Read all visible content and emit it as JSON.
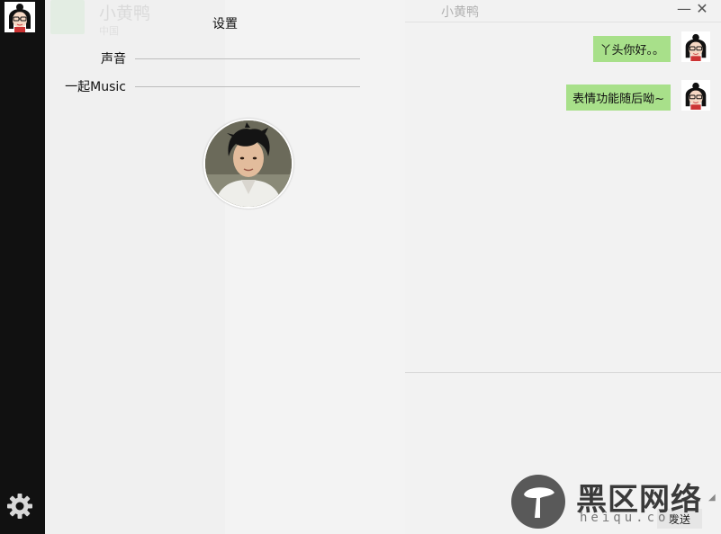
{
  "rail": {
    "avatar_icon": "cartoon-girl-avatar",
    "settings_icon": "gear-icon"
  },
  "drawer": {
    "title": "设置",
    "ghost_contact": {
      "name": "小黄鸭",
      "sub": "中国"
    },
    "settings": [
      {
        "label": "声音"
      },
      {
        "label": "一起Music"
      }
    ],
    "profile_icon": "profile-photo"
  },
  "chat": {
    "title": "小黄鸭",
    "minimize": "—",
    "close": "✕",
    "messages": [
      {
        "text": "丫头你好。。"
      },
      {
        "text": "表情功能随后呦~"
      }
    ],
    "send_label": "发送",
    "bubble_color": "#a8e08a"
  },
  "watermark": {
    "title": "黑区网络",
    "sub": "heiqu.com"
  }
}
